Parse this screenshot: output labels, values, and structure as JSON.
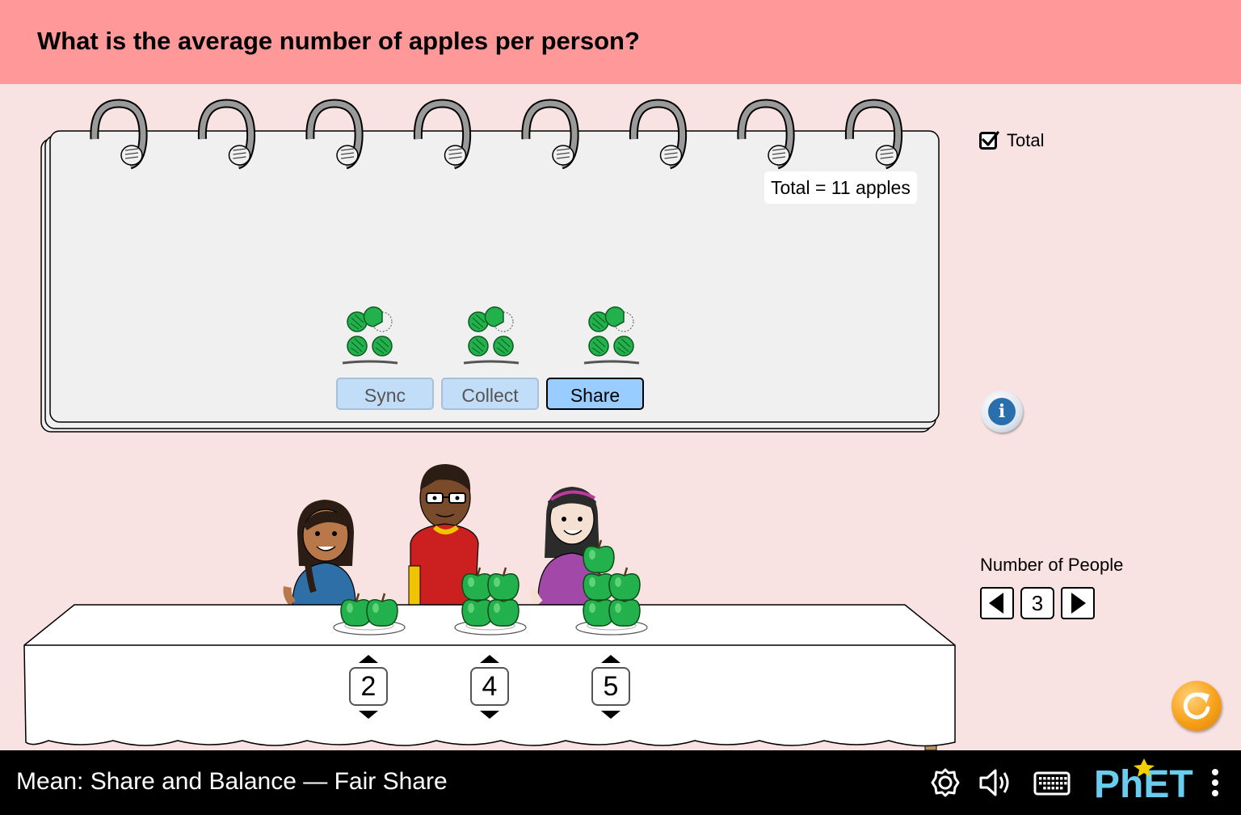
{
  "question": "What is the average number of apples per person?",
  "notepad": {
    "total_readout": "Total = 11 apples",
    "buttons": {
      "sync": "Sync",
      "collect": "Collect",
      "share": "Share"
    },
    "selected_mode": "Share",
    "fair_share_plates": [
      3.67,
      3.67,
      3.67
    ]
  },
  "controls": {
    "total_checkbox": {
      "label": "Total",
      "checked": true
    },
    "number_of_people": {
      "title": "Number of People",
      "value": "3"
    }
  },
  "people": [
    {
      "apples": "2"
    },
    {
      "apples": "4"
    },
    {
      "apples": "5"
    }
  ],
  "navbar": {
    "sim_title": "Mean: Share and Balance — Fair Share",
    "brand": "PhET"
  },
  "colors": {
    "header": "#ff9999",
    "background": "#f8e2e2",
    "apple_green": "#22b14c",
    "share_button": "#99cdff",
    "reset_orange": "#f7a11a"
  },
  "icons": [
    "info-icon",
    "reset-icon",
    "settings-icon",
    "sound-icon",
    "keyboard-icon",
    "more-options-icon",
    "checkmark-icon"
  ]
}
